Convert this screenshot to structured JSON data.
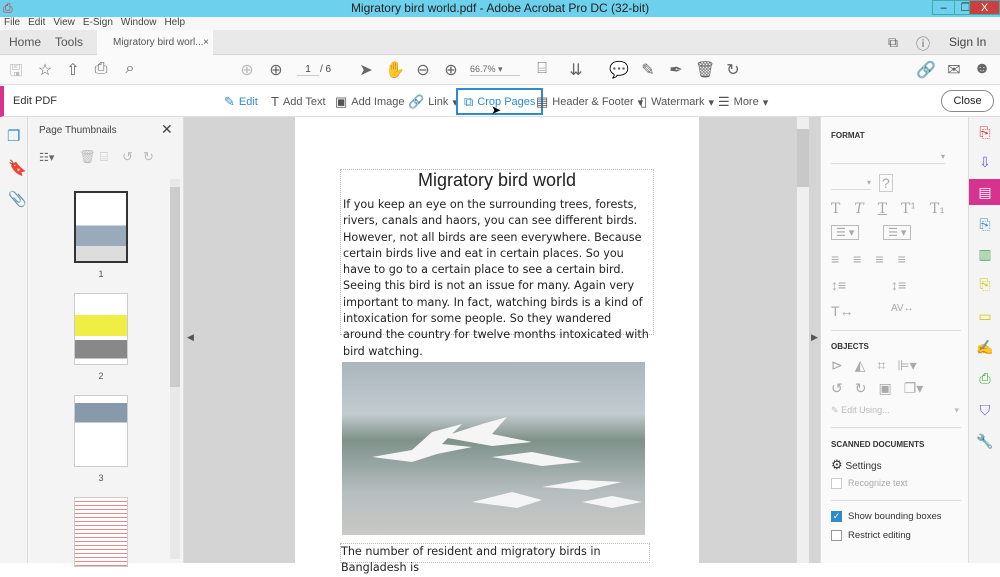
{
  "window": {
    "title": "Migratory bird world.pdf - Adobe Acrobat Pro DC (32-bit)",
    "min": "–",
    "restore": "❐",
    "close": "X"
  },
  "menu": [
    "File",
    "Edit",
    "View",
    "E-Sign",
    "Window",
    "Help"
  ],
  "tabs": {
    "home": "Home",
    "tools": "Tools",
    "doc": "Migratory bird worl...",
    "close": "×",
    "sign_in": "Sign In"
  },
  "toolbar": {
    "page_current": "1",
    "page_total": "/ 6",
    "zoom": "66.7%"
  },
  "editbar": {
    "title": "Edit PDF",
    "edit": "Edit",
    "add_text": "Add Text",
    "add_image": "Add Image",
    "link": "Link",
    "crop": "Crop Pages",
    "header_footer": "Header & Footer",
    "watermark": "Watermark",
    "more": "More",
    "close": "Close"
  },
  "thumbnails": {
    "title": "Page Thumbnails",
    "pages": [
      "1",
      "2",
      "3"
    ]
  },
  "document": {
    "heading": "Migratory bird world",
    "paragraph": "If you keep an eye on the surrounding trees, forests, rivers, canals and haors, you can see different birds. However, not all birds are seen everywhere. Because certain birds live and eat in certain places. So you have to go to a certain place to see a certain bird. Seeing this bird is not an issue for many. Again very important to many. In fact, watching birds is a kind of intoxication for some people. So they wandered around the country for twelve months intoxicated with bird watching.",
    "next_line": "The number of resident and migratory birds in Bangladesh is"
  },
  "format_panel": {
    "format": "FORMAT",
    "objects": "OBJECTS",
    "edit_using": "Edit Using...",
    "scanned": "SCANNED DOCUMENTS",
    "settings": "Settings",
    "recognize": "Recognize text",
    "show_boxes": "Show bounding boxes",
    "show_boxes_checked": true,
    "restrict": "Restrict editing",
    "restrict_checked": false
  },
  "colors": {
    "accent": "#d6338f",
    "titlebar": "#6dd0ec",
    "link_blue": "#2d8ccd"
  }
}
